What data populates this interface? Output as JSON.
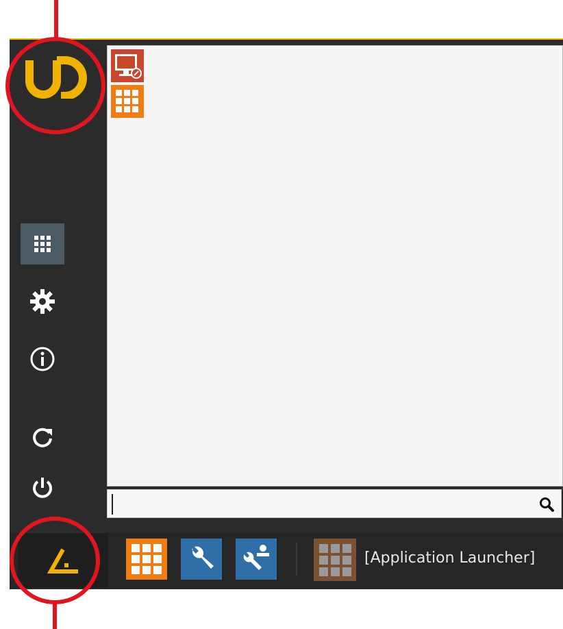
{
  "launcher": {
    "brand": "UD",
    "search": {
      "value": "",
      "placeholder": ""
    },
    "sidebar": {
      "items": [
        {
          "icon": "apps-grid-icon",
          "active": true
        },
        {
          "icon": "gear-icon",
          "active": false
        },
        {
          "icon": "info-icon",
          "active": false
        },
        {
          "icon": "refresh-icon",
          "active": false
        },
        {
          "icon": "power-icon",
          "active": false
        }
      ]
    },
    "apps": [
      {
        "icon": "remote-desktop-icon",
        "color": "#c9462c"
      },
      {
        "icon": "app-grid-icon",
        "color": "#f07c14"
      }
    ]
  },
  "taskbar": {
    "start_icon": "igel-start-icon",
    "buttons": [
      {
        "icon": "app-launcher-grid-icon",
        "color": "#f07c14"
      },
      {
        "icon": "wrench-icon",
        "color": "#2f6ea6"
      },
      {
        "icon": "user-wrench-icon",
        "color": "#2f6ea6"
      }
    ],
    "active_task": {
      "icon": "app-launcher-grid-icon",
      "label": "[Application Launcher]"
    }
  },
  "colors": {
    "accent": "#f0b400",
    "callout": "#e0151f",
    "dark": "#2b2b2b"
  }
}
